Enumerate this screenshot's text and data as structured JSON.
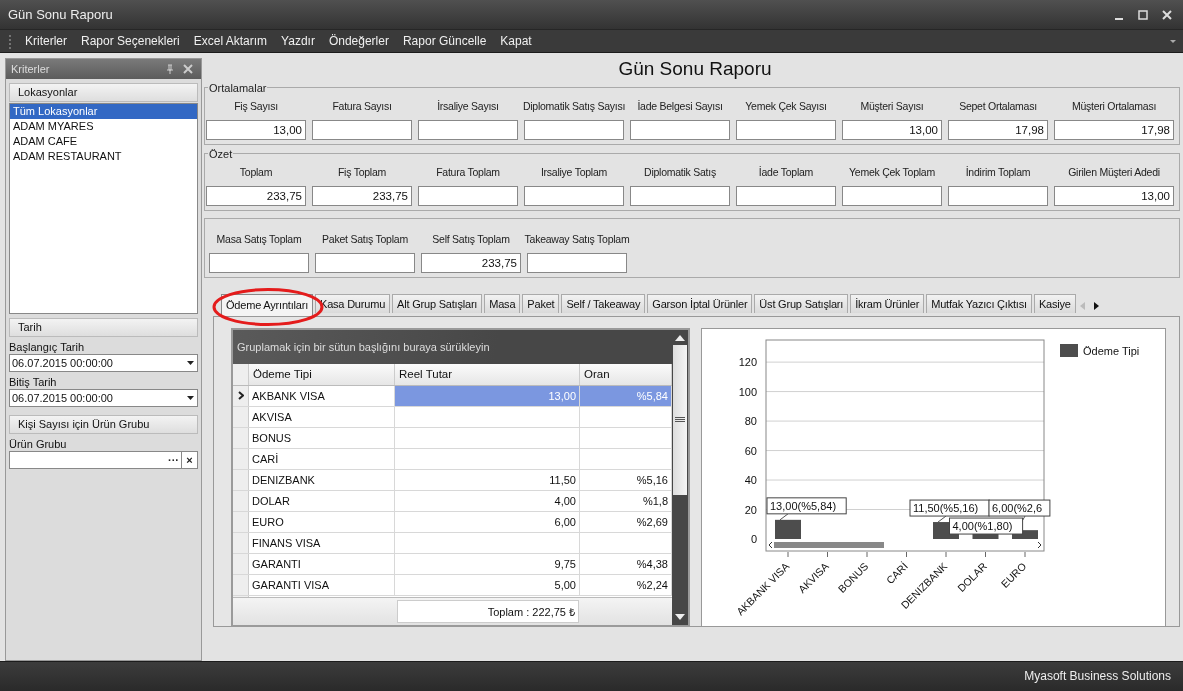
{
  "window": {
    "title": "Gün Sonu Raporu"
  },
  "menu": [
    "Kriterler",
    "Rapor Seçenekleri",
    "Excel Aktarım",
    "Yazdır",
    "Öndeğerler",
    "Rapor Güncelle",
    "Kapat"
  ],
  "criteria_panel": {
    "title": "Kriterler",
    "locations": {
      "title": "Lokasyonlar",
      "items": [
        {
          "label": "Tüm Lokasyonlar",
          "selected": true
        },
        {
          "label": "ADAM MYARES",
          "selected": false
        },
        {
          "label": "ADAM CAFE",
          "selected": false
        },
        {
          "label": "ADAM RESTAURANT",
          "selected": false
        }
      ]
    },
    "date": {
      "title": "Tarih",
      "start_label": "Başlangıç Tarih",
      "start_value": "06.07.2015 00:00:00",
      "end_label": "Bitiş Tarih",
      "end_value": "06.07.2015 00:00:00"
    },
    "product_group": {
      "title": "Kişi Sayısı için Ürün Grubu",
      "label": "Ürün Grubu",
      "browse": "···",
      "clear": "×"
    }
  },
  "report_title": "Gün Sonu Raporu",
  "averages": {
    "title": "Ortalamalar",
    "fields": [
      {
        "label": "Fiş Sayısı",
        "value": "13,00"
      },
      {
        "label": "Fatura Sayısı"
      },
      {
        "label": "İrsaliye Sayısı"
      },
      {
        "label": "Diplomatik Satış Sayısı"
      },
      {
        "label": "İade Belgesi Sayısı"
      },
      {
        "label": "Yemek Çek Sayısı"
      },
      {
        "label": "Müşteri Sayısı",
        "value": "13,00"
      },
      {
        "label": "Sepet Ortalaması",
        "value": "17,98"
      },
      {
        "label": "Müşteri Ortalaması",
        "value": "17,98"
      }
    ]
  },
  "summary": {
    "title": "Özet",
    "fields": [
      {
        "label": "Toplam",
        "value": "233,75"
      },
      {
        "label": "Fiş Toplam",
        "value": "233,75"
      },
      {
        "label": "Fatura Toplam"
      },
      {
        "label": "Irsaliye Toplam"
      },
      {
        "label": "Diplomatik Satış"
      },
      {
        "label": "İade Toplam"
      },
      {
        "label": "Yemek Çek Toplam"
      },
      {
        "label": "İndirim Toplam"
      },
      {
        "label": "Girilen Müşteri Adedi",
        "value": "13,00"
      }
    ]
  },
  "sales": {
    "fields": [
      {
        "label": "Masa Satış Toplam"
      },
      {
        "label": "Paket Satış Toplam"
      },
      {
        "label": "Self Satış Toplam",
        "value": "233,75"
      },
      {
        "label": "Takeaway Satış Toplam"
      }
    ]
  },
  "tabs": [
    {
      "label": "Ödeme Ayrıntıları",
      "selected": true
    },
    {
      "label": "Kasa Durumu",
      "selected": false
    },
    {
      "label": "Alt Grup Satışları",
      "selected": false
    },
    {
      "label": "Masa",
      "selected": false
    },
    {
      "label": "Paket",
      "selected": false
    },
    {
      "label": "Self / Takeaway",
      "selected": false
    },
    {
      "label": "Garson İptal Ürünler",
      "selected": false
    },
    {
      "label": "Üst Grup Satışları",
      "selected": false
    },
    {
      "label": "İkram Ürünler",
      "selected": false
    },
    {
      "label": "Mutfak Yazıcı Çıktısı",
      "selected": false
    },
    {
      "label": "Kasiye",
      "selected": false
    }
  ],
  "grid": {
    "group_hint": "Gruplamak için bir sütun başlığını buraya sürükleyin",
    "columns": [
      "Ödeme Tipi",
      "Reel Tutar",
      "Oran"
    ],
    "rows": [
      {
        "name": "AKBANK VISA",
        "amount": "13,00",
        "ratio": "%5,84",
        "selected": true
      },
      {
        "name": "AKVISA",
        "selected": false
      },
      {
        "name": "BONUS",
        "selected": false
      },
      {
        "name": "CARİ",
        "selected": false
      },
      {
        "name": "DENIZBANK",
        "amount": "11,50",
        "ratio": "%5,16",
        "selected": false
      },
      {
        "name": "DOLAR",
        "amount": "4,00",
        "ratio": "%1,8",
        "selected": false
      },
      {
        "name": "EURO",
        "amount": "6,00",
        "ratio": "%2,69",
        "selected": false
      },
      {
        "name": "FINANS VISA",
        "selected": false
      },
      {
        "name": "GARANTI",
        "amount": "9,75",
        "ratio": "%4,38",
        "selected": false
      },
      {
        "name": "GARANTI VISA",
        "amount": "5,00",
        "ratio": "%2,24",
        "selected": false
      }
    ],
    "footer_total": "Toplam : 222,75 ₺"
  },
  "chart": {
    "chart_data": {
      "type": "bar",
      "categories": [
        "AKBANK VISA",
        "AKVISA",
        "BONUS",
        "CARİ",
        "DENIZBANK",
        "DOLAR",
        "EURO"
      ],
      "series": [
        {
          "name": "Ödeme Tipi",
          "color": "#4d4d4d",
          "values": [
            13,
            null,
            null,
            null,
            11.5,
            4,
            6
          ]
        }
      ],
      "ylim": [
        0,
        135
      ],
      "grid": true,
      "yticks": [
        0,
        20,
        40,
        60,
        80,
        100,
        120
      ],
      "value_labels": [
        "13,00(%5,84)",
        null,
        null,
        null,
        "11,50(%5,16)",
        "4,00(%1,80)",
        "6,00(%2,6"
      ]
    }
  },
  "status_bar": "Myasoft Business Solutions"
}
